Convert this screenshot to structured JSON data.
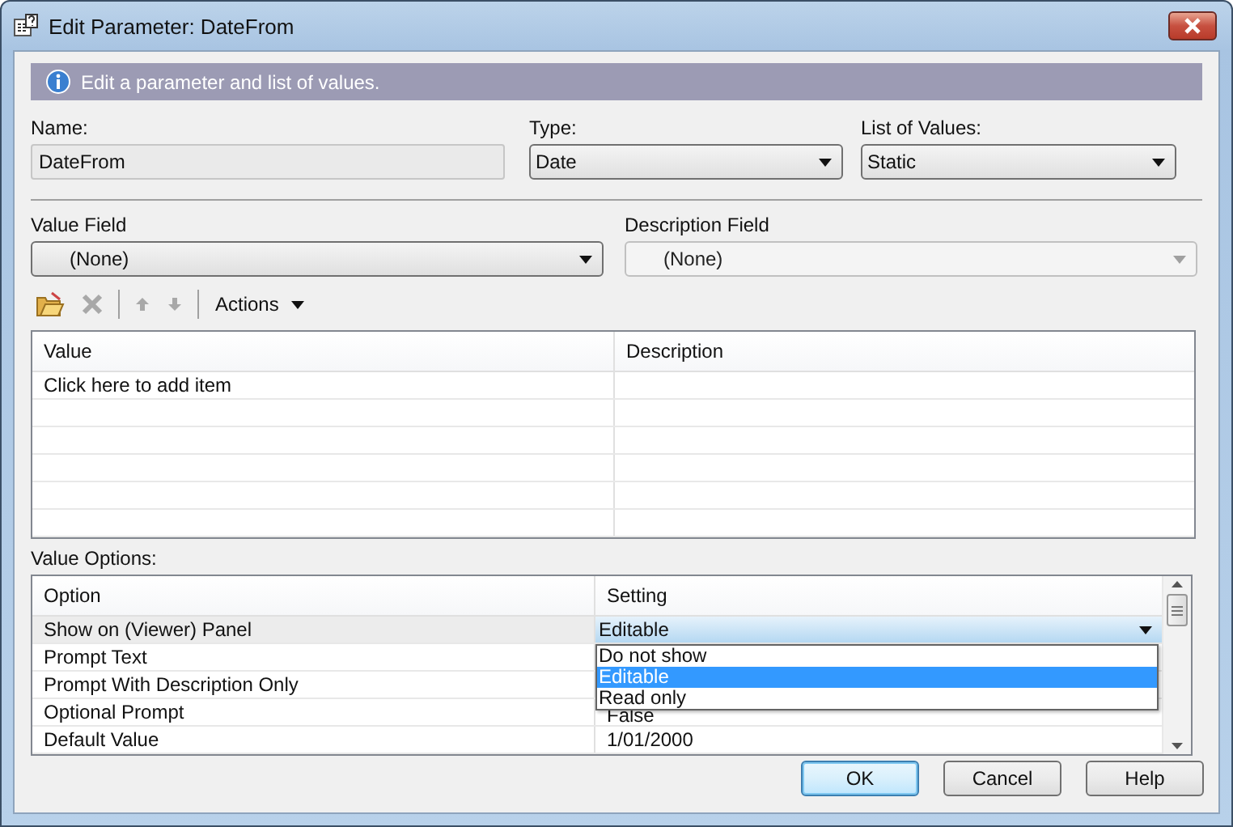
{
  "window": {
    "title": "Edit Parameter: DateFrom"
  },
  "banner": {
    "text": "Edit a parameter and list of values."
  },
  "name_field": {
    "label": "Name:",
    "value": "DateFrom"
  },
  "type_field": {
    "label": "Type:",
    "value": "Date"
  },
  "list_of_values_field": {
    "label": "List of Values:",
    "value": "Static"
  },
  "value_field": {
    "label": "Value Field",
    "value": "(None)",
    "disabled": false
  },
  "description_field": {
    "label": "Description Field",
    "value": "(None)",
    "disabled": true
  },
  "toolbar": {
    "items": [
      {
        "kind": "add",
        "disabled": false
      },
      {
        "kind": "delete",
        "disabled": true
      },
      {
        "kind": "separator"
      },
      {
        "kind": "up",
        "disabled": true
      },
      {
        "kind": "down",
        "disabled": true
      },
      {
        "kind": "separator"
      },
      {
        "kind": "menu",
        "label": "Actions"
      }
    ]
  },
  "values_table": {
    "columns": [
      "Value",
      "Description"
    ],
    "rows": [
      {
        "value": "Click here to add item"
      }
    ]
  },
  "value_options": {
    "label": "Value Options:",
    "columns": [
      "Option",
      "Setting"
    ],
    "rows": [
      {
        "option": "Show on (Viewer) Panel",
        "setting": "Editable",
        "selected": true
      },
      {
        "option": "Prompt Text",
        "selected": false
      },
      {
        "option": "Prompt With Description Only",
        "selected": false
      },
      {
        "option": "Optional Prompt",
        "setting": "False",
        "selected": false
      },
      {
        "option": "Default Value",
        "setting": "1/01/2000",
        "selected": false
      }
    ],
    "dropdown": {
      "items": [
        {
          "label": "Do not show",
          "selected": false
        },
        {
          "label": "Editable",
          "selected": true
        },
        {
          "label": "Read only",
          "selected": false
        }
      ]
    }
  },
  "buttons": [
    {
      "label": "OK",
      "default": true
    },
    {
      "label": "Cancel",
      "default": false
    },
    {
      "label": "Help",
      "default": false
    }
  ]
}
